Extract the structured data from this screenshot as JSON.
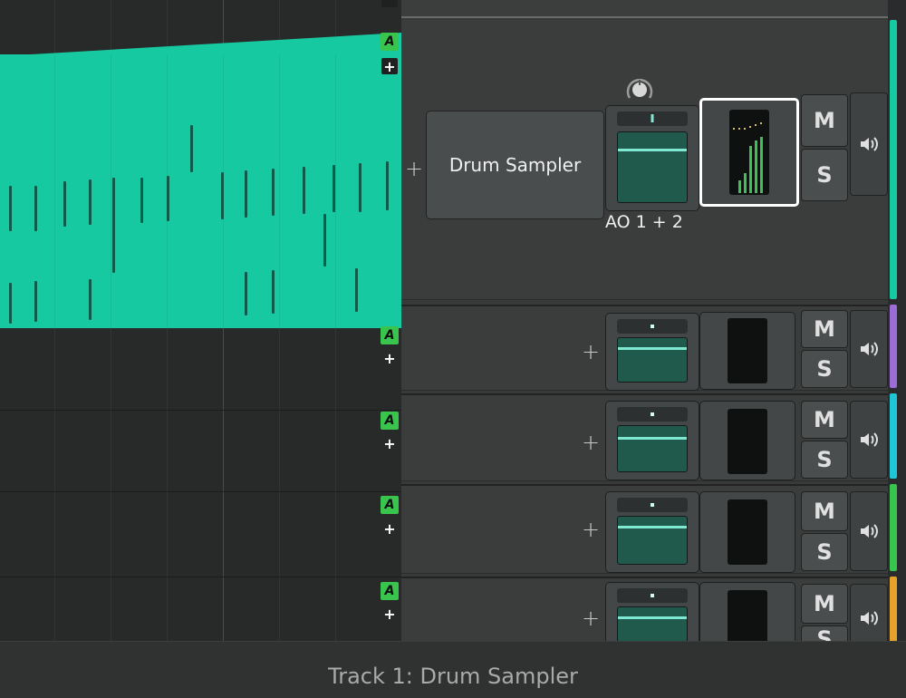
{
  "clip_track": {
    "badge": "A",
    "add_symbol": "+"
  },
  "tracks": [
    {
      "name": "Drum Sampler",
      "io_label": "AO 1 + 2",
      "mute": "M",
      "solo": "S",
      "add_symbol": "+",
      "color": "#17c9a1",
      "badge": "A"
    },
    {
      "mute": "M",
      "solo": "S",
      "add_symbol": "+",
      "color": "#9b6bd6",
      "badge": "A"
    },
    {
      "mute": "M",
      "solo": "S",
      "add_symbol": "+",
      "color": "#1fc6d6",
      "badge": "A"
    },
    {
      "mute": "M",
      "solo": "S",
      "add_symbol": "+",
      "color": "#39c44e",
      "badge": "A"
    },
    {
      "mute": "M",
      "solo": "S",
      "add_symbol": "+",
      "color": "#e6a12c",
      "badge": "A"
    }
  ],
  "icons": {
    "speaker": "speaker-icon",
    "knob": "input-knob-icon"
  },
  "footer": {
    "title": "Track 1: Drum Sampler"
  }
}
